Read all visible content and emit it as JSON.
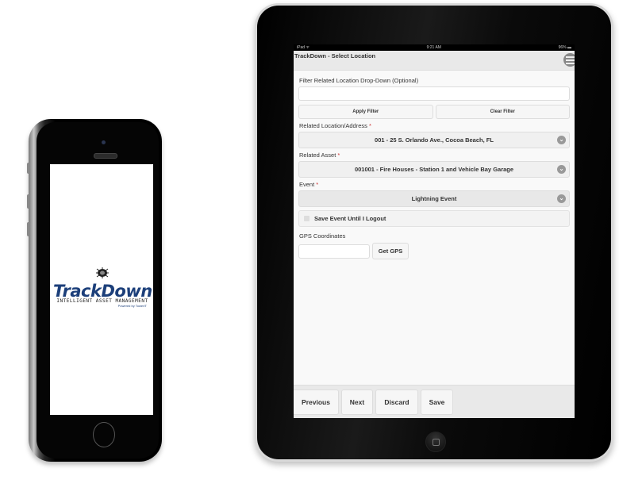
{
  "iphone": {
    "logo": {
      "title": "TrackDown",
      "subtitle": "INTELLIGENT ASSET MANAGEMENT",
      "powered_by": "Powered by TowerIT"
    }
  },
  "ipad": {
    "statusbar": {
      "device": "iPad ᯤ",
      "time": "9:21 AM",
      "battery": "96% ▬"
    },
    "header": {
      "title": "TrackDown - Select Location",
      "menu_icon": "hamburger-icon"
    },
    "form": {
      "filter_label": "Filter Related Location Drop-Down (Optional)",
      "filter_value": "",
      "apply_filter": "Apply Filter",
      "clear_filter": "Clear Filter",
      "location_label": "Related Location/Address",
      "location_value": "001 - 25 S. Orlando Ave., Cocoa Beach, FL",
      "asset_label": "Related Asset",
      "asset_value": "001001 - Fire Houses - Station 1 and Vehicle Bay Garage",
      "event_label": "Event",
      "event_value": "Lightning Event",
      "required_marker": "*",
      "save_event_label": "Save Event Until I Logout",
      "save_event_checked": false,
      "gps_label": "GPS Coordinates",
      "gps_value": "",
      "get_gps": "Get GPS"
    },
    "footer": {
      "previous": "Previous",
      "next": "Next",
      "discard": "Discard",
      "save": "Save"
    }
  }
}
